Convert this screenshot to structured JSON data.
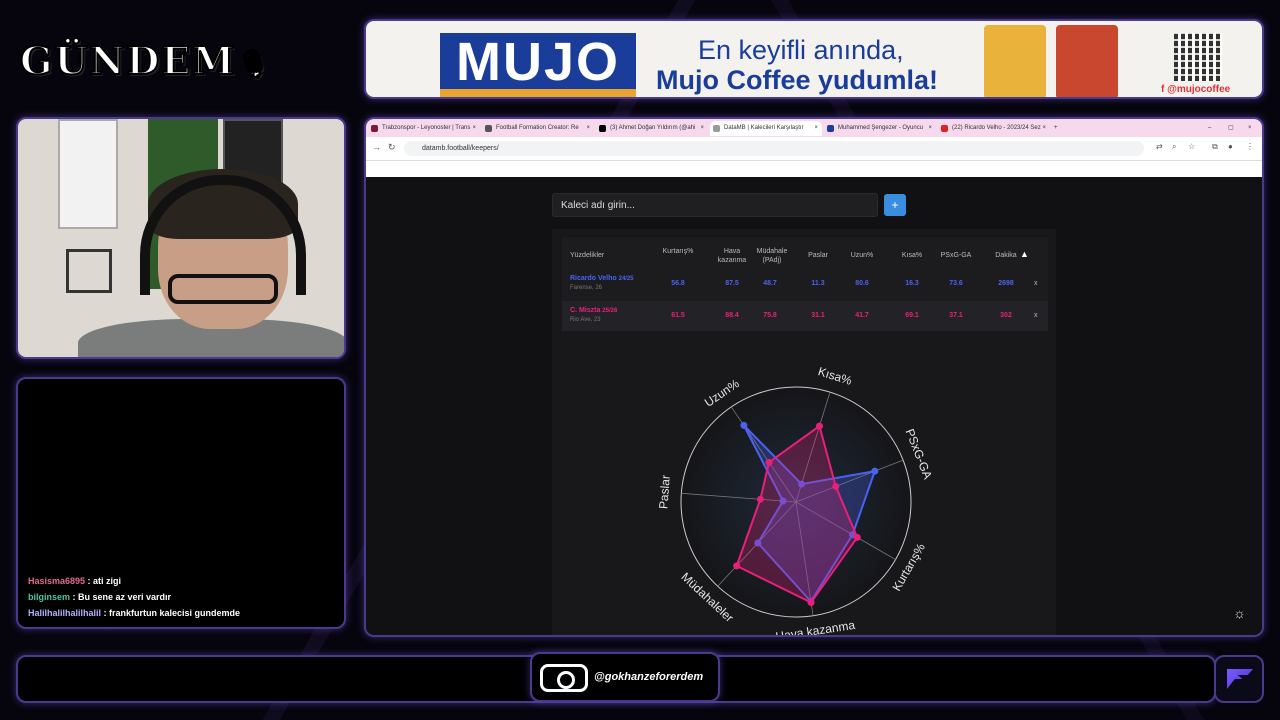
{
  "overlay": {
    "logo_text": "GÜNDEM",
    "instagram_handle": "@gokhanzeforerdem"
  },
  "ad": {
    "brand": "MUJO",
    "line1": "En keyifli anında,",
    "line2": "Mujo Coffee yudumla!",
    "social": "@mujocoffee"
  },
  "chat": {
    "messages": [
      {
        "user": "Hasisma6895",
        "text": " : ati zigi",
        "color": "#e06b8f"
      },
      {
        "user": "bilginsem",
        "text": " : Bu sene az veri vardır",
        "color": "#4ec3a3"
      },
      {
        "user": "Halilhalilhalilhalil",
        "text": " : frankfurtun kalecisi gundemde",
        "color": "#b6b0ff"
      }
    ]
  },
  "browser": {
    "tabs": [
      {
        "title": "Trabzonspor - Leyonoster | Trans",
        "color": "#7a1b3a"
      },
      {
        "title": "Football Formation Creator: Re",
        "color": "#555"
      },
      {
        "title": "(3) Ahmet Doğan Yıldırım (@ahi",
        "color": "#000"
      },
      {
        "title": "DataMB | Kalecileri Karşılaştır",
        "color": "#999"
      },
      {
        "title": "Muhammed Şengezer - Oyuncu",
        "color": "#1b3d9a"
      },
      {
        "title": "(22) Ricardo Velho - 2023/24 Sez",
        "color": "#d22"
      }
    ],
    "url": "datamb.football/keepers/"
  },
  "app": {
    "search_placeholder": "Kaleci adı girin...",
    "add_label": "+",
    "headers": [
      "Yüzdelikler",
      "Kurtarış%",
      "Hava kazanma",
      "Müdahale (PAdj)",
      "Paslar",
      "Uzun%",
      "Kısa%",
      "PSxG-GA",
      "Dakika"
    ],
    "players": [
      {
        "name": "Ricardo Velho",
        "season": "24/25",
        "sub": "Farense, 26",
        "values": [
          "56.8",
          "87.5",
          "48.7",
          "11.3",
          "80.6",
          "16.3",
          "73.6",
          "2698"
        ],
        "remove": "x"
      },
      {
        "name": "C. Miszta",
        "season": "25/26",
        "sub": "Rio Ave, 23",
        "values": [
          "61.5",
          "88.4",
          "75.8",
          "31.1",
          "41.7",
          "69.1",
          "37.1",
          "302"
        ],
        "remove": "x"
      }
    ]
  },
  "chart_data": {
    "type": "radar",
    "axes": [
      "Kısa%",
      "PSxG-GA",
      "Kurtarış%",
      "Hava kazanma",
      "Müdahaleler",
      "Paslar",
      "Uzun%"
    ],
    "max": 100,
    "series": [
      {
        "name": "Ricardo Velho",
        "color": "#4a62f0",
        "values": [
          16.3,
          73.6,
          56.8,
          87.5,
          48.7,
          11.3,
          80.6
        ]
      },
      {
        "name": "C. Miszta",
        "color": "#e8207a",
        "values": [
          69.1,
          37.1,
          61.5,
          88.4,
          75.8,
          31.1,
          41.7
        ]
      }
    ]
  }
}
